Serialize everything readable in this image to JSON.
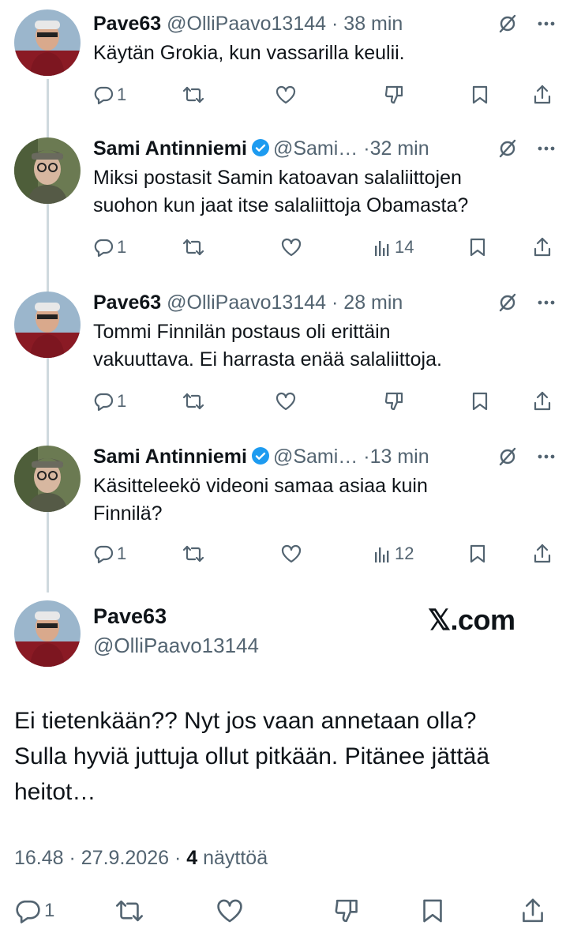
{
  "replies": [
    {
      "name": "Pave63",
      "verified": false,
      "handle": "@OlliPaavo13144",
      "sep": "·",
      "time": "38 min",
      "text": [
        "Käytän Grokia, kun vassarilla keulii."
      ],
      "reply_count": "1",
      "views": ""
    },
    {
      "name": "Sami Antinniemi",
      "verified": true,
      "handle": "@Sami…",
      "sep": "·",
      "time": "32 min",
      "text": [
        "Miksi postasit Samin katoavan salaliittojen",
        "suohon kun jaat itse salaliittoja Obamasta?"
      ],
      "reply_count": "1",
      "views": "14"
    },
    {
      "name": "Pave63",
      "verified": false,
      "handle": "@OlliPaavo13144",
      "sep": "·",
      "time": "28 min",
      "text": [
        "Tommi Finnilän postaus oli erittäin",
        "vakuuttava. Ei harrasta enää salaliittoja."
      ],
      "reply_count": "1",
      "views": ""
    },
    {
      "name": "Sami Antinniemi",
      "verified": true,
      "handle": "@Sami…",
      "sep": "·",
      "time": "13 min",
      "text": [
        "Käsitteleekö videoni samaa asiaa kuin",
        "Finnilä?"
      ],
      "reply_count": "1",
      "views": "12"
    }
  ],
  "main": {
    "name": "Pave63",
    "handle": "@OlliPaavo13144",
    "watermark": "𝕏.com",
    "text": [
      "Ei tietenkään?? Nyt jos vaan annetaan olla?",
      "Sulla hyviä juttuja ollut pitkään. Pitänee jättää",
      "heitot…"
    ],
    "time": "16.48",
    "sep": "·",
    "date": "27.9.2026",
    "views_count": "4",
    "views_label": "näyttöä",
    "reply_count": "1"
  },
  "colors": {
    "accent": "#1d9bf0",
    "muted": "#536471",
    "text": "#0f1419",
    "line": "#cfd9de"
  },
  "icons": [
    "reply-icon",
    "repost-icon",
    "like-icon",
    "dislike-icon",
    "bookmark-icon",
    "share-icon",
    "views-icon",
    "grok-icon",
    "more-icon",
    "verified-badge-icon"
  ]
}
